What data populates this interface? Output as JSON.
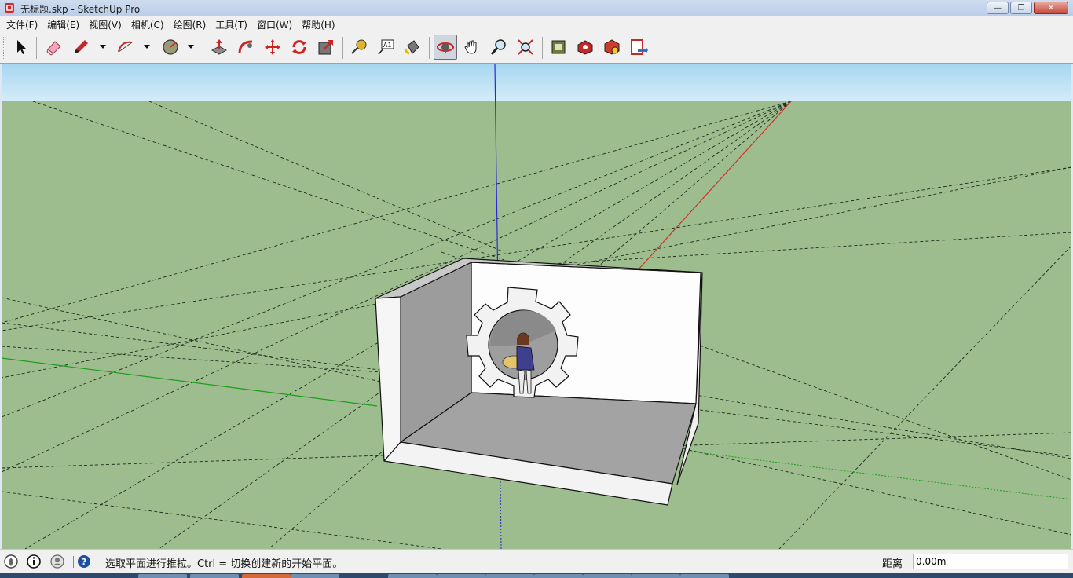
{
  "window": {
    "title": "无标题.skp - SketchUp Pro",
    "minimize_symbol": "—",
    "restore_symbol": "❐",
    "close_symbol": "✕"
  },
  "menu": {
    "items": [
      "文件(F)",
      "编辑(E)",
      "视图(V)",
      "相机(C)",
      "绘图(R)",
      "工具(T)",
      "窗口(W)",
      "帮助(H)"
    ]
  },
  "toolbar": {
    "tools": [
      {
        "name": "select-tool-icon"
      },
      {
        "name": "eraser-tool-icon"
      },
      {
        "name": "pencil-line-tool-icon"
      },
      {
        "name": "arc-tool-icon"
      },
      {
        "name": "shape-tool-icon"
      },
      {
        "name": "push-pull-tool-icon"
      },
      {
        "name": "follow-me-tool-icon"
      },
      {
        "name": "move-tool-icon"
      },
      {
        "name": "rotate-tool-icon"
      },
      {
        "name": "scale-tool-icon"
      },
      {
        "name": "tape-measure-tool-icon"
      },
      {
        "name": "text-tool-icon"
      },
      {
        "name": "paint-bucket-tool-icon"
      },
      {
        "name": "orbit-tool-icon",
        "active": true
      },
      {
        "name": "pan-tool-icon"
      },
      {
        "name": "zoom-tool-icon"
      },
      {
        "name": "zoom-extents-tool-icon"
      },
      {
        "name": "3d-warehouse-icon"
      },
      {
        "name": "share-model-icon"
      },
      {
        "name": "extension-warehouse-icon"
      },
      {
        "name": "send-to-layout-icon"
      }
    ],
    "text_tool_label": "A1"
  },
  "colors": {
    "sky_top": "#a9d8f1",
    "sky_bottom": "#d3ecf8",
    "ground": "#9dbd8e",
    "axis_red": "#d0302a",
    "axis_green": "#1a9e1a",
    "axis_blue": "#2a2ad0"
  },
  "status": {
    "message": "选取平面进行推拉。Ctrl = 切换创建新的开始平面。",
    "vcb_label": "距离",
    "vcb_value": "0.00m"
  }
}
